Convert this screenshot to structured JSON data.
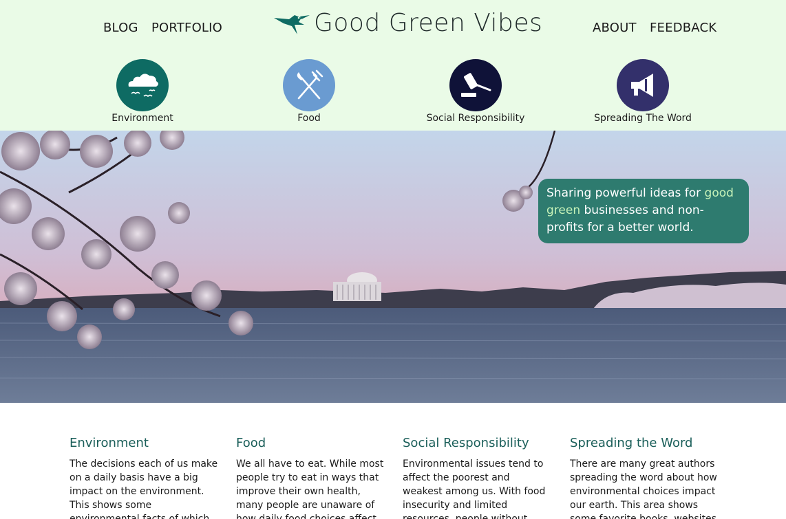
{
  "header": {
    "nav_left": [
      "BLOG",
      "PORTFOLIO"
    ],
    "nav_right": [
      "ABOUT",
      "FEEDBACK"
    ],
    "logo_text": "Good Green Vibes",
    "categories": [
      {
        "label": "Environment",
        "icon": "cloud-birds-icon",
        "color": "#0e6b63"
      },
      {
        "label": "Food",
        "icon": "fork-knife-icon",
        "color": "#6a9bd1"
      },
      {
        "label": "Social Responsibility",
        "icon": "gavel-icon",
        "color": "#0f1238"
      },
      {
        "label": "Spreading The Word",
        "icon": "megaphone-icon",
        "color": "#33306b"
      }
    ]
  },
  "hero": {
    "tagline_before": "Sharing powerful ideas for ",
    "tagline_highlight": "good green",
    "tagline_after": " businesses and non-profits for a better world."
  },
  "sections": [
    {
      "title": "Environment",
      "text": "The decisions each of us make on a daily basis have a big impact on the environment. This shows some environmental facts of which you might be"
    },
    {
      "title": "Food",
      "text": "We all have to eat. While most people try to eat in ways that improve their own health, many people are unaware of how daily food choices affect the"
    },
    {
      "title": "Social Responsibility",
      "text": "Environmental issues tend to affect the poorest and weakest among us. With food insecurity and limited resources, people without monetary wealth are"
    },
    {
      "title": "Spreading the Word",
      "text": "There are many great authors spreading the word about how environmental choices impact our earth. This area shows some favorite books, websites"
    }
  ],
  "colors": {
    "header_bg": "#eafbe7",
    "accent": "#2e7b6f",
    "heading": "#1b5f5a",
    "highlight": "#c6f2b8"
  }
}
